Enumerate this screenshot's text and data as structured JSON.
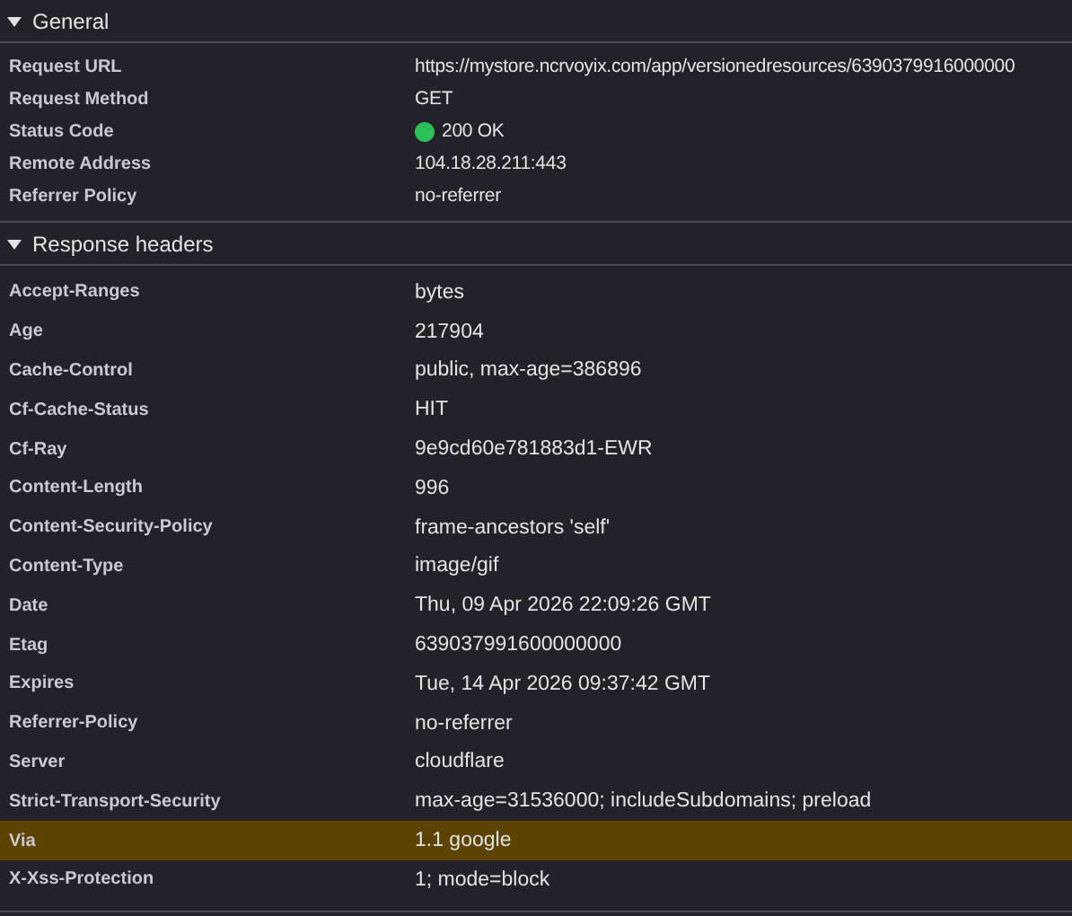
{
  "sections": [
    {
      "title": "General",
      "expanded": true,
      "rows": [
        {
          "name": "Request URL",
          "value": "https://mystore.ncrvoyix.com/app/versionedresources/6390379916000000",
          "kind": "text",
          "highlighted": false
        },
        {
          "name": "Request Method",
          "value": "GET",
          "kind": "text",
          "highlighted": false
        },
        {
          "name": "Status Code",
          "value": "200 OK",
          "kind": "status",
          "highlighted": false
        },
        {
          "name": "Remote Address",
          "value": "104.18.28.211:443",
          "kind": "text",
          "highlighted": false
        },
        {
          "name": "Referrer Policy",
          "value": "no-referrer",
          "kind": "text",
          "highlighted": false
        }
      ]
    },
    {
      "title": "Response headers",
      "expanded": true,
      "rows": [
        {
          "name": "Accept-Ranges",
          "value": "bytes",
          "kind": "text",
          "highlighted": false
        },
        {
          "name": "Age",
          "value": "217904",
          "kind": "text",
          "highlighted": false
        },
        {
          "name": "Cache-Control",
          "value": "public, max-age=386896",
          "kind": "text",
          "highlighted": false
        },
        {
          "name": "Cf-Cache-Status",
          "value": "HIT",
          "kind": "text",
          "highlighted": false
        },
        {
          "name": "Cf-Ray",
          "value": "9e9cd60e781883d1-EWR",
          "kind": "text",
          "highlighted": false
        },
        {
          "name": "Content-Length",
          "value": "996",
          "kind": "text",
          "highlighted": false
        },
        {
          "name": "Content-Security-Policy",
          "value": "frame-ancestors 'self'",
          "kind": "text",
          "highlighted": false
        },
        {
          "name": "Content-Type",
          "value": "image/gif",
          "kind": "text",
          "highlighted": false
        },
        {
          "name": "Date",
          "value": "Thu, 09 Apr 2026 22:09:26 GMT",
          "kind": "text",
          "highlighted": false
        },
        {
          "name": "Etag",
          "value": "639037991600000000",
          "kind": "text",
          "highlighted": false
        },
        {
          "name": "Expires",
          "value": "Tue, 14 Apr 2026 09:37:42 GMT",
          "kind": "text",
          "highlighted": false
        },
        {
          "name": "Referrer-Policy",
          "value": "no-referrer",
          "kind": "text",
          "highlighted": false
        },
        {
          "name": "Server",
          "value": "cloudflare",
          "kind": "text",
          "highlighted": false
        },
        {
          "name": "Strict-Transport-Security",
          "value": "max-age=31536000; includeSubdomains; preload",
          "kind": "text",
          "highlighted": false
        },
        {
          "name": "Via",
          "value": "1.1 google",
          "kind": "text",
          "highlighted": true
        },
        {
          "name": "X-Xss-Protection",
          "value": "1; mode=block",
          "kind": "text",
          "highlighted": false
        }
      ]
    }
  ]
}
